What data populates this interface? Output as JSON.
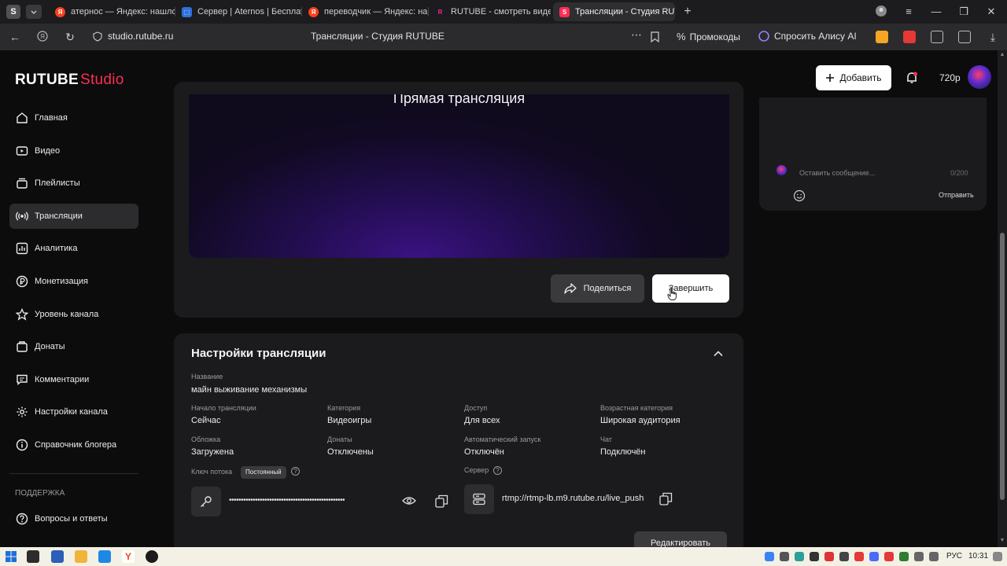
{
  "browser": {
    "tabs": [
      {
        "title": "атернос — Яндекс: нашлось",
        "favicon": "yandex",
        "color": "#fc3f1d",
        "active": false
      },
      {
        "title": "Сервер | Aternos | Бесплатно",
        "favicon": "aternos",
        "color": "#3b82f6",
        "active": false
      },
      {
        "title": "переводчик — Яндекс: нашлось",
        "favicon": "yandex",
        "color": "#fc3f1d",
        "active": false
      },
      {
        "title": "RUTUBE - смотреть видео",
        "favicon": "rutube",
        "color": "#1a1a2e",
        "active": false
      },
      {
        "title": "Трансляции - Студия RUTUBE",
        "favicon": "rutube-studio",
        "color": "#ff2d55",
        "active": true
      }
    ],
    "url": "studio.rutube.ru",
    "page_title": "Трансляции - Студия RUTUBE",
    "promo_label": "Промокоды",
    "alice_label": "Спросить Алису AI"
  },
  "app": {
    "logo_main": "RUTUBE",
    "logo_studio": "Studio",
    "add_label": "Добавить",
    "balance": "720р",
    "accent": "#ff2d55"
  },
  "sidebar": {
    "items": [
      {
        "label": "Главная",
        "icon": "home-icon",
        "active": false
      },
      {
        "label": "Видео",
        "icon": "video-icon",
        "active": false
      },
      {
        "label": "Плейлисты",
        "icon": "playlist-icon",
        "active": false
      },
      {
        "label": "Трансляции",
        "icon": "broadcast-icon",
        "active": true
      },
      {
        "label": "Аналитика",
        "icon": "analytics-icon",
        "active": false
      },
      {
        "label": "Монетизация",
        "icon": "ruble-icon",
        "active": false
      },
      {
        "label": "Уровень канала",
        "icon": "star-icon",
        "active": false
      },
      {
        "label": "Донаты",
        "icon": "donate-icon",
        "active": false
      },
      {
        "label": "Комментарии",
        "icon": "comment-icon",
        "active": false
      },
      {
        "label": "Настройки канала",
        "icon": "gear-icon",
        "active": false
      },
      {
        "label": "Справочник блогера",
        "icon": "info-icon",
        "active": false
      }
    ],
    "support_section": "ПОДДЕРЖКА",
    "support_items": [
      {
        "label": "Вопросы и ответы",
        "icon": "help-icon"
      }
    ]
  },
  "player": {
    "title": "Прямая трансляция",
    "share_label": "Поделиться",
    "finish_label": "Завершить"
  },
  "chat": {
    "placeholder": "Оставить сообщение...",
    "counter": "0/200",
    "send_label": "Отправить"
  },
  "settings": {
    "title": "Настройки трансляции",
    "name_label": "Название",
    "name_value": "майн выживание механизмы",
    "fields": [
      {
        "label": "Начало трансляции",
        "value": "Сейчас"
      },
      {
        "label": "Категория",
        "value": "Видеоигры"
      },
      {
        "label": "Доступ",
        "value": "Для всех"
      },
      {
        "label": "Возрастная категория",
        "value": "Широкая аудитория"
      },
      {
        "label": "Обложка",
        "value": "Загружена"
      },
      {
        "label": "Донаты",
        "value": "Отключены"
      },
      {
        "label": "Автоматический запуск",
        "value": "Отключён"
      },
      {
        "label": "Чат",
        "value": "Подключён"
      }
    ],
    "stream_key_label": "Ключ потока",
    "stream_key_badge": "Постоянный",
    "stream_key_masked": "•••••••••••••••••••••••••••••••••••••••••••••••••",
    "server_label": "Сервер",
    "server_url": "rtmp://rtmp-lb.m9.rutube.ru/live_push",
    "edit_label": "Редактировать"
  },
  "taskbar": {
    "lang": "РУС",
    "time": "10:31"
  }
}
